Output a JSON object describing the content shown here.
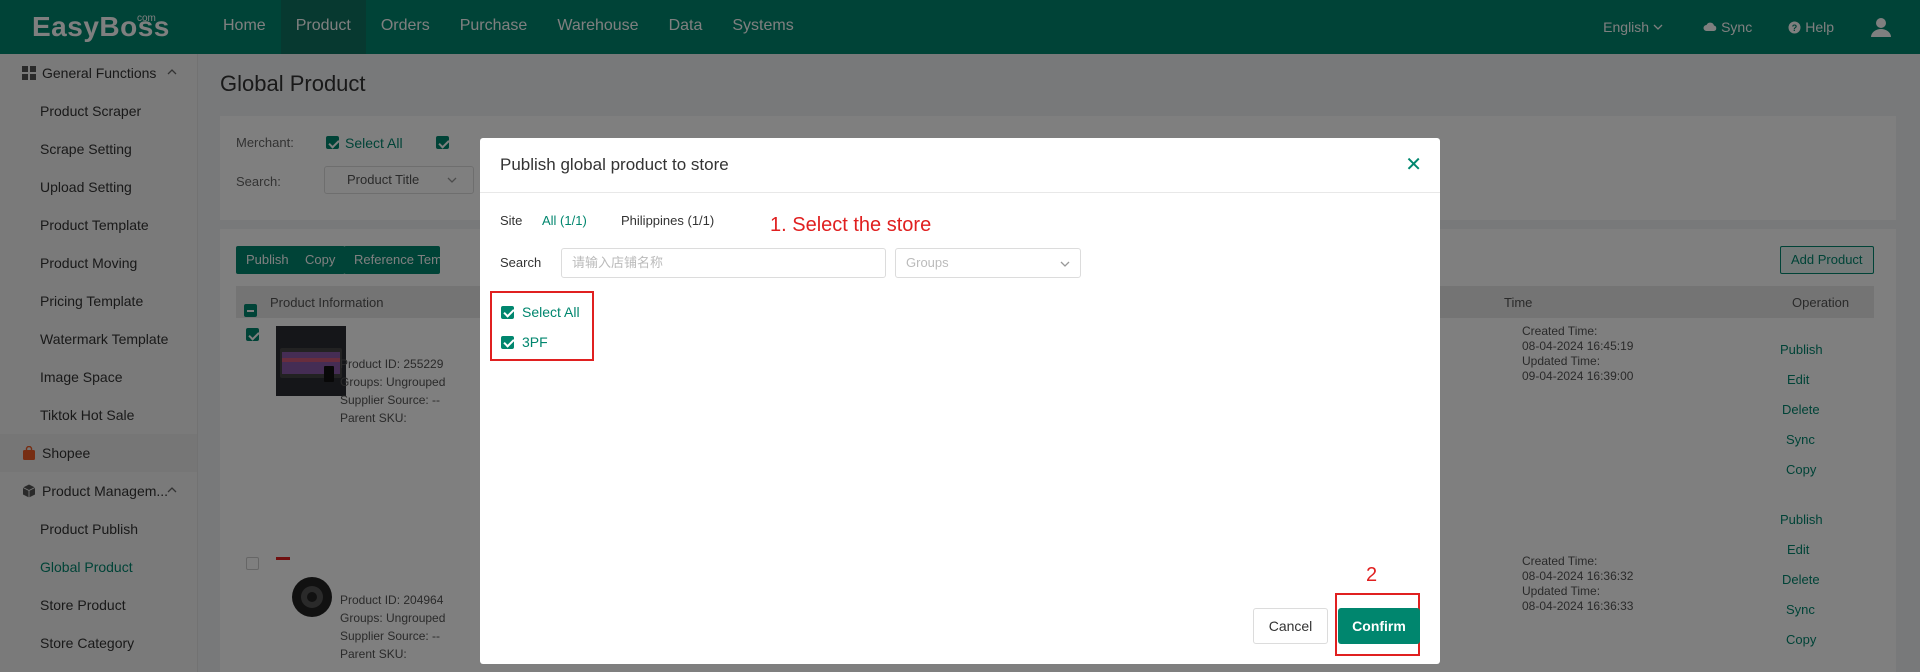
{
  "header": {
    "logo": "EasyBoss",
    "logo_suffix": "com",
    "nav": [
      "Home",
      "Product",
      "Orders",
      "Purchase",
      "Warehouse",
      "Data",
      "Systems"
    ],
    "language": "English",
    "sync": "Sync",
    "help": "Help"
  },
  "sidebar": {
    "general": "General Functions",
    "general_items": [
      "Product Scraper",
      "Scrape Setting",
      "Upload Setting",
      "Product Template",
      "Product Moving",
      "Pricing Template",
      "Watermark Template",
      "Image Space",
      "Tiktok Hot Sale"
    ],
    "shopee": "Shopee",
    "product_mgmt": "Product Managem...",
    "pm_items": [
      "Product Publish",
      "Global Product",
      "Store Product",
      "Store Category"
    ]
  },
  "page": {
    "title": "Global Product",
    "merchant_label": "Merchant:",
    "select_all": "Select All",
    "search_label": "Search:",
    "search_field": "Product Title",
    "btn_publish": "Publish",
    "btn_copy": "Copy",
    "btn_reference": "Reference Templa",
    "btn_add": "Add Product",
    "col_info": "Product Information",
    "col_time": "Time",
    "col_operation": "Operation",
    "rows": [
      {
        "product_id": "Product ID:  255229",
        "groups": "Groups:  Ungrouped",
        "supplier": "Supplier Source:  --",
        "parent_sku": "Parent SKU:",
        "created_label": "Created Time:",
        "created": "08-04-2024 16:45:19",
        "updated_label": "Updated Time:",
        "updated": "09-04-2024 16:39:00"
      },
      {
        "product_id": "Product ID:  204964",
        "groups": "Groups:  Ungrouped",
        "supplier": "Supplier Source:  --",
        "parent_sku": "Parent SKU:",
        "created_label": "Created Time:",
        "created": "08-04-2024 16:36:32",
        "updated_label": "Updated Time:",
        "updated": "08-04-2024 16:36:33"
      }
    ],
    "ops": [
      "Publish",
      "Edit",
      "Delete",
      "Sync",
      "Copy"
    ]
  },
  "modal": {
    "title": "Publish global product to store",
    "site_label": "Site",
    "site_all": "All (1/1)",
    "site_ph": "Philippines (1/1)",
    "search_label": "Search",
    "search_placeholder": "请输入店铺名称",
    "groups_placeholder": "Groups",
    "select_all": "Select All",
    "store": "3PF",
    "cancel": "Cancel",
    "confirm": "Confirm"
  },
  "annotations": {
    "step1": "1. Select the store",
    "step2": "2"
  },
  "colors": {
    "brand": "#00866e",
    "annotation": "#e02020"
  }
}
